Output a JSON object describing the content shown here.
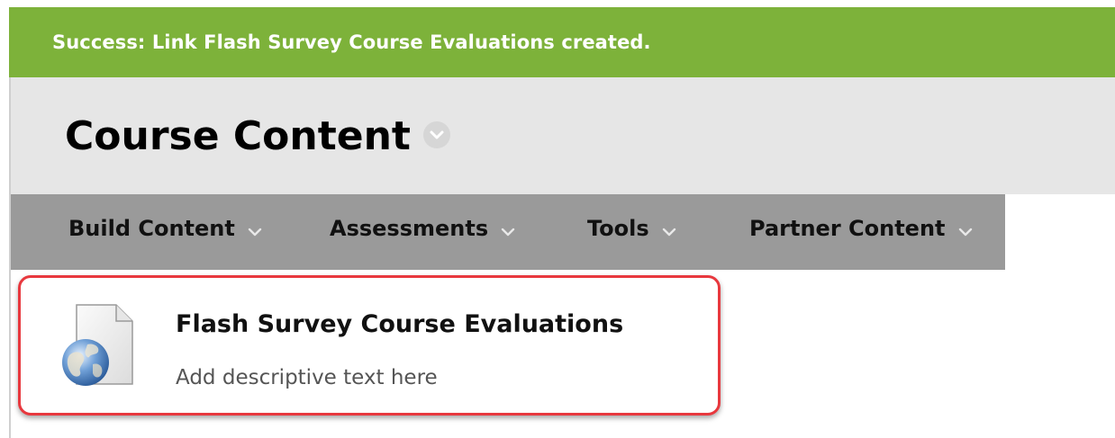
{
  "notification": {
    "message": "Success: Link Flash Survey Course Evaluations created."
  },
  "header": {
    "title": "Course Content"
  },
  "toolbar": {
    "items": [
      {
        "label": "Build Content"
      },
      {
        "label": "Assessments"
      },
      {
        "label": "Tools"
      },
      {
        "label": "Partner Content"
      }
    ]
  },
  "content_item": {
    "title": "Flash Survey Course Evaluations",
    "description": "Add descriptive text here",
    "icon": "web-link-document-icon"
  },
  "colors": {
    "success_bar": "#7db23a",
    "header_bg": "#e6e6e6",
    "toolbar_bg": "#9a9a9a",
    "highlight_border": "#e8383e"
  }
}
